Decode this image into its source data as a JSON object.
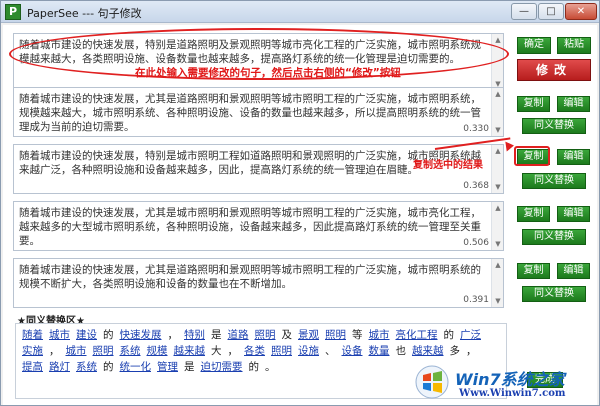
{
  "window": {
    "app_name": "PaperSee",
    "title": "PaperSee --- 句子修改",
    "icon_letter": "P",
    "minimize": "—",
    "maximize": "□",
    "close": "✕"
  },
  "input": {
    "text": "随着城市建设的快速发展，特别是道路照明及景观照明等城市亮化工程的广泛实施，城市照明系统规模越来越大，各类照明设施、设备数量也越来越多，提高路灯系统的统一化管理是迫切需要的。",
    "hint": "在此处输入需要修改的句子，然后点击右侧的“修改”按钮"
  },
  "buttons": {
    "confirm": "确定",
    "paste": "粘贴",
    "modify": "修改",
    "copy": "复制",
    "edit": "编辑",
    "synonym_replace": "同义替换",
    "done": "完成"
  },
  "results": [
    {
      "text": "随着城市建设的快速发展，尤其是道路照明和景观照明等城市照明工程的广泛实施，城市照明系统，规模越来越大，城市照明系统、各种照明设施、设备的数量也越来越多，所以提高照明系统的统一管理成为当前的迫切需要。",
      "score": "0.330"
    },
    {
      "text": "随着城市建设的快速发展，特别是城市照明工程如道路照明和景观照明的广泛实施，城市照明系统越来越广泛，各种照明设施和设备越来越多，因此，提高路灯系统的统一管理迫在眉睫。",
      "score": "0.368"
    },
    {
      "text": "随着城市建设的快速发展，尤其是城市照明和景观照明等城市照明工程的广泛实施，城市亮化工程，越来越多的大型城市照明系统，各种照明设施，设备越来越多，因此提高路灯系统的统一管理至关重要。",
      "score": "0.506"
    },
    {
      "text": "随着城市建设的快速发展，尤其是道路照明和景观照明等城市照明工程的广泛实施，城市照明系统的规模不断扩大，各类照明设施和设备的数量也在不断增加。",
      "score": "0.391"
    }
  ],
  "annotation_copy": "复制选中的结果",
  "synonym": {
    "header": "★同义替换区★",
    "words": [
      {
        "w": "随着",
        "link": true
      },
      {
        "w": "城市",
        "link": true
      },
      {
        "w": "建设",
        "link": true
      },
      {
        "w": "的",
        "link": false
      },
      {
        "w": "快速发展",
        "link": true
      },
      {
        "w": "，",
        "link": false
      },
      {
        "w": "特别",
        "link": true
      },
      {
        "w": "是",
        "link": false
      },
      {
        "w": "道路",
        "link": true
      },
      {
        "w": "照明",
        "link": true
      },
      {
        "w": "及",
        "link": false
      },
      {
        "w": "景观",
        "link": true
      },
      {
        "w": "照明",
        "link": true
      },
      {
        "w": "等",
        "link": false
      },
      {
        "w": "城市",
        "link": true
      },
      {
        "w": "亮化工程",
        "link": true
      },
      {
        "w": "的",
        "link": false
      },
      {
        "w": "广泛",
        "link": true
      },
      {
        "w": "实施",
        "link": true
      },
      {
        "w": "，",
        "link": false
      },
      {
        "w": "城市",
        "link": true
      },
      {
        "w": "照明",
        "link": true
      },
      {
        "w": "系统",
        "link": true
      },
      {
        "w": "规模",
        "link": true
      },
      {
        "w": "越来越",
        "link": true
      },
      {
        "w": "大",
        "link": false
      },
      {
        "w": "，",
        "link": false
      },
      {
        "w": "各类",
        "link": true
      },
      {
        "w": "照明",
        "link": true
      },
      {
        "w": "设施",
        "link": true
      },
      {
        "w": "、",
        "link": false
      },
      {
        "w": "设备",
        "link": true
      },
      {
        "w": "数量",
        "link": true
      },
      {
        "w": "也",
        "link": false
      },
      {
        "w": "越来越",
        "link": true
      },
      {
        "w": "多",
        "link": false
      },
      {
        "w": "，",
        "link": false
      },
      {
        "w": "提高",
        "link": true
      },
      {
        "w": "路灯",
        "link": true
      },
      {
        "w": "系统",
        "link": true
      },
      {
        "w": "的",
        "link": false
      },
      {
        "w": "统一化",
        "link": true
      },
      {
        "w": "管理",
        "link": true
      },
      {
        "w": "是",
        "link": false
      },
      {
        "w": "迫切需要",
        "link": true
      },
      {
        "w": "的",
        "link": false
      },
      {
        "w": "。",
        "link": false
      }
    ]
  },
  "watermark": {
    "brand": "Win7系统之家",
    "url": "Www.Winwin7.com"
  },
  "colors": {
    "accent_green": "#1d7a1d",
    "accent_red": "#b71d1d",
    "link_blue": "#1a3fb0"
  }
}
